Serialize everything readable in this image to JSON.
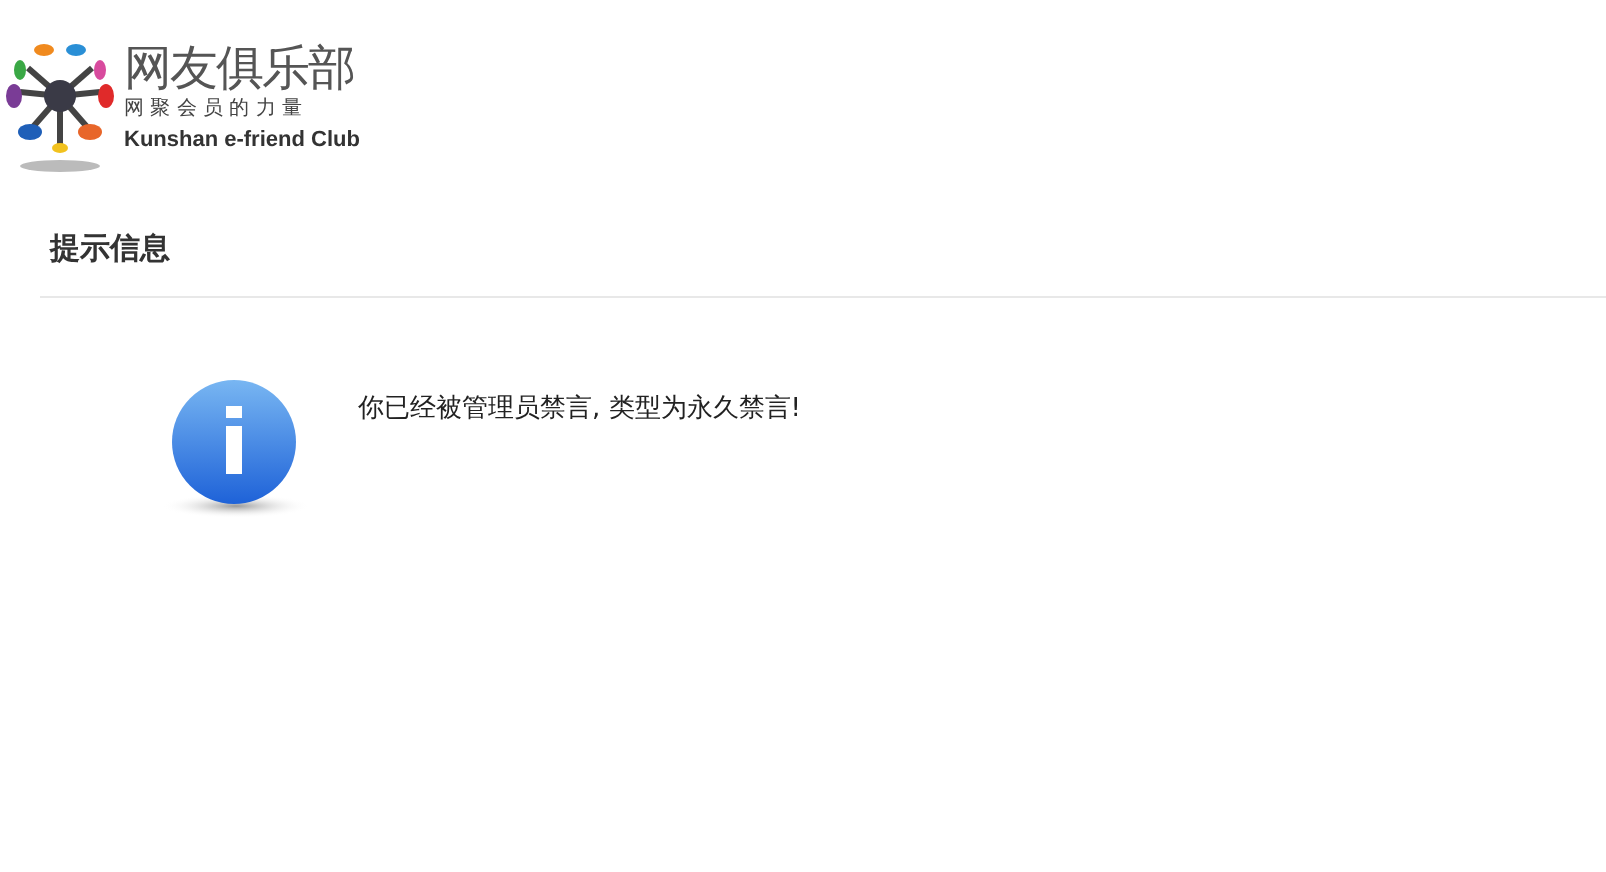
{
  "logo": {
    "name": "网友俱乐部",
    "slogan": "网 聚 会 员 的 力 量",
    "subtitle": "Kunshan e-friend Club"
  },
  "notice": {
    "title": "提示信息",
    "message": "你已经被管理员禁言, 类型为永久禁言!"
  }
}
